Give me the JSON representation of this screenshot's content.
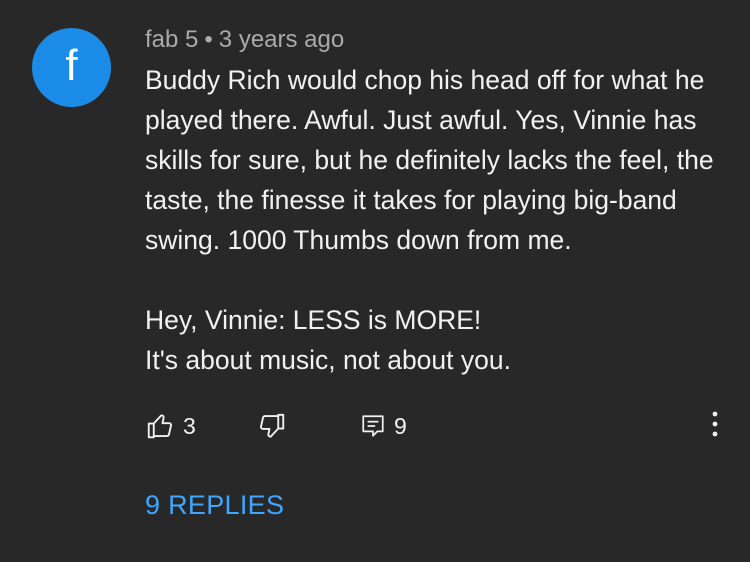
{
  "comment": {
    "avatar_letter": "f",
    "avatar_color": "#1a8be6",
    "author": "fab 5",
    "separator": "•",
    "timestamp": "3 years ago",
    "paragraphs": [
      "Buddy Rich would chop his head off for what he played there. Awful. Just awful. Yes, Vinnie has skills for sure, but he definitely lacks the feel, the taste, the finesse it takes for playing big-band swing. 1000 Thumbs down from me."
    ],
    "lines_after_gap": [
      "Hey, Vinnie: LESS is MORE!",
      "It's about music, not about you."
    ]
  },
  "actions": {
    "like_icon": "thumbs-up-icon",
    "like_count": "3",
    "dislike_icon": "thumbs-down-icon",
    "reply_icon": "reply-comment-icon",
    "reply_count": "9",
    "more_icon": "more-vertical-icon"
  },
  "replies_label": "9 REPLIES",
  "colors": {
    "background": "#282828",
    "text": "#f1f1f1",
    "secondary_text": "#aaaaaa",
    "link": "#3ea6ff"
  }
}
